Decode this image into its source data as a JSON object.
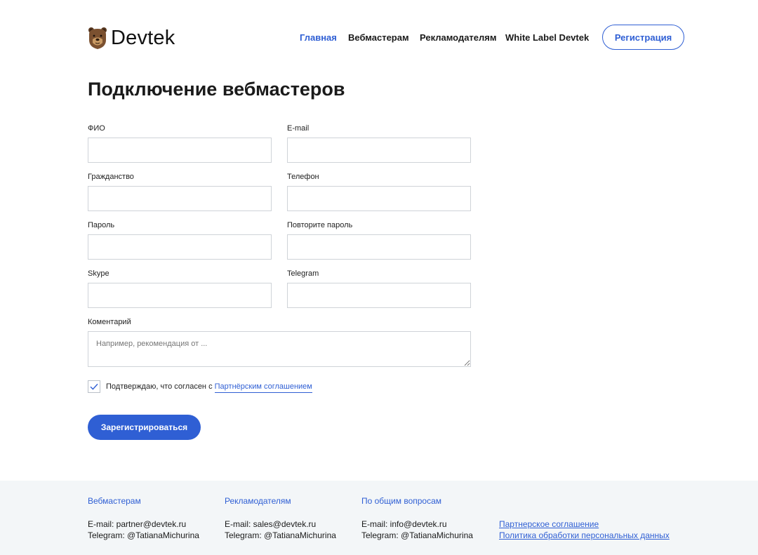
{
  "header": {
    "logo_text": "Devtek",
    "logo_icon": "bear-logo-icon",
    "nav": [
      {
        "label": "Главная",
        "active": true
      },
      {
        "label": "Вебмастерам",
        "active": false
      },
      {
        "label": "Рекламодателям",
        "active": false
      },
      {
        "label": "White Label Devtek",
        "active": false
      }
    ],
    "register_button": "Регистрация"
  },
  "page": {
    "title": "Подключение вебмастеров"
  },
  "form": {
    "fields": [
      {
        "label": "ФИО",
        "value": "",
        "placeholder": ""
      },
      {
        "label": "E-mail",
        "value": "",
        "placeholder": ""
      },
      {
        "label": "Гражданство",
        "value": "",
        "placeholder": ""
      },
      {
        "label": "Телефон",
        "value": "",
        "placeholder": ""
      },
      {
        "label": "Пароль",
        "value": "",
        "placeholder": ""
      },
      {
        "label": "Повторите пароль",
        "value": "",
        "placeholder": ""
      },
      {
        "label": "Skype",
        "value": "",
        "placeholder": ""
      },
      {
        "label": "Telegram",
        "value": "",
        "placeholder": ""
      }
    ],
    "comment": {
      "label": "Коментарий",
      "placeholder": "Например, рекомендация от ..."
    },
    "agreement": {
      "checked": true,
      "text": "Подтверждаю, что согласен с",
      "link": "Партнёрским соглашением"
    },
    "submit_label": "Зарегистрироваться"
  },
  "footer": {
    "columns": [
      {
        "heading": "Вебмастерам",
        "email": "E-mail: partner@devtek.ru",
        "telegram": "Telegram: @TatianaMichurina"
      },
      {
        "heading": "Рекламодателям",
        "email": "E-mail: sales@devtek.ru",
        "telegram": "Telegram: @TatianaMichurina"
      },
      {
        "heading": "По общим вопросам",
        "email": "E-mail: info@devtek.ru",
        "telegram": "Telegram: @TatianaMichurina"
      }
    ],
    "links": [
      "Партнерское соглашение",
      "Политика обработки персональных данных"
    ]
  },
  "colors": {
    "accent": "#2f5fd4",
    "footer_bg": "#f3f6f8",
    "input_border": "#cfd3d8"
  }
}
